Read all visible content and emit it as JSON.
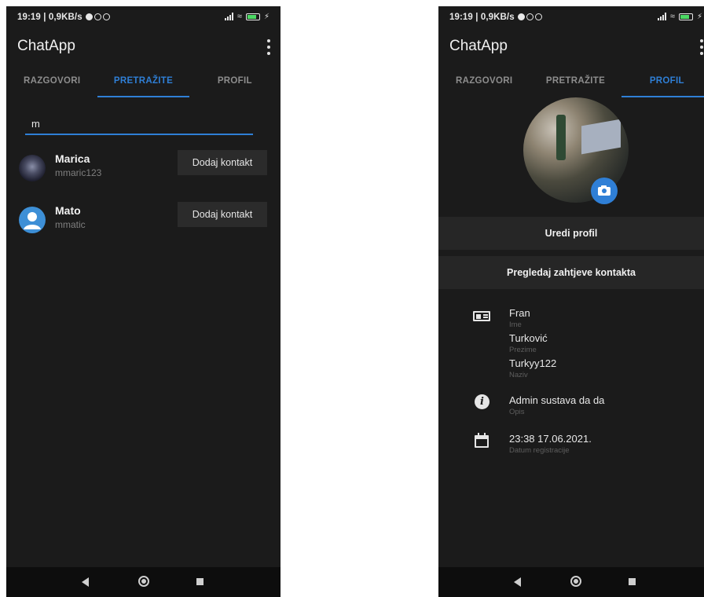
{
  "status": {
    "time": "19:19 | 0,9KB/s"
  },
  "app_title": "ChatApp",
  "tabs": [
    "RAZGOVORI",
    "PRETRAŽITE",
    "PROFIL"
  ],
  "search": {
    "query": "m"
  },
  "results": [
    {
      "name": "Marica",
      "username": "mmaric123",
      "button": "Dodaj kontakt",
      "avatar": "photo"
    },
    {
      "name": "Mato",
      "username": "mmatic",
      "button": "Dodaj kontakt",
      "avatar": "person-icon"
    }
  ],
  "profile": {
    "edit_button": "Uredi profil",
    "requests_button": "Pregledaj zahtjeve kontakta",
    "first_name": "Fran",
    "first_name_label": "Ime",
    "last_name": "Turković",
    "last_name_label": "Prezime",
    "nickname": "Turkyy122",
    "nickname_label": "Naziv",
    "description": "Admin sustava da da",
    "description_label": "Opis",
    "registered": "23:38 17.06.2021.",
    "registered_label": "Datum registracije"
  },
  "colors": {
    "accent": "#2f7fd6",
    "background": "#1b1b1b",
    "button": "#2b2b2b"
  }
}
